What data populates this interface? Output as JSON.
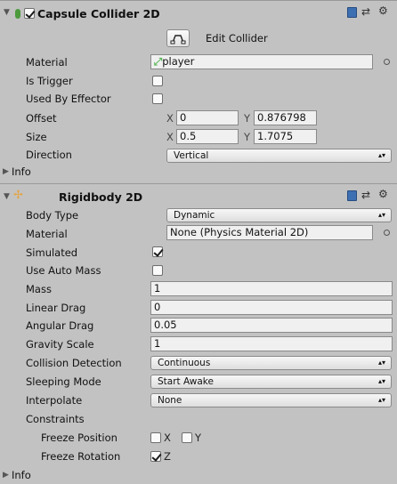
{
  "capsule": {
    "title": "Capsule Collider 2D",
    "enabled": true,
    "edit_collider_label": "Edit Collider",
    "rows": {
      "material_label": "Material",
      "material_value": "player",
      "is_trigger_label": "Is Trigger",
      "is_trigger": false,
      "used_by_effector_label": "Used By Effector",
      "used_by_effector": false,
      "offset_label": "Offset",
      "offset_x": "0",
      "offset_y": "0.876798",
      "size_label": "Size",
      "size_x": "0.5",
      "size_y": "1.7075",
      "direction_label": "Direction",
      "direction_value": "Vertical",
      "info_label": "Info"
    },
    "axis_x": "X",
    "axis_y": "Y"
  },
  "rigidbody": {
    "title": "Rigidbody 2D",
    "rows": {
      "body_type_label": "Body Type",
      "body_type_value": "Dynamic",
      "material_label": "Material",
      "material_value": "None (Physics Material 2D)",
      "simulated_label": "Simulated",
      "simulated": true,
      "use_auto_mass_label": "Use Auto Mass",
      "use_auto_mass": false,
      "mass_label": "Mass",
      "mass_value": "1",
      "linear_drag_label": "Linear Drag",
      "linear_drag_value": "0",
      "angular_drag_label": "Angular Drag",
      "angular_drag_value": "0.05",
      "gravity_scale_label": "Gravity Scale",
      "gravity_scale_value": "1",
      "collision_detection_label": "Collision Detection",
      "collision_detection_value": "Continuous",
      "sleeping_mode_label": "Sleeping Mode",
      "sleeping_mode_value": "Start Awake",
      "interpolate_label": "Interpolate",
      "interpolate_value": "None",
      "constraints_label": "Constraints",
      "freeze_position_label": "Freeze Position",
      "freeze_position_x": false,
      "freeze_position_y": false,
      "freeze_rotation_label": "Freeze Rotation",
      "freeze_rotation_z": true,
      "info_label": "Info"
    },
    "axis_x": "X",
    "axis_y": "Y",
    "axis_z": "Z"
  },
  "icons": {
    "collider": "capsule-collider-icon",
    "rigidbody": "rigidbody-icon",
    "help": "help-book-icon",
    "presets": "presets-icon",
    "settings": "gear-icon",
    "object_picker": "object-picker-icon",
    "edit_collider": "edit-collider-icon"
  },
  "colors": {
    "panel_bg": "#c2c2c2",
    "field_bg": "#f0f0f0",
    "collider_icon": "#5cb85c",
    "help_icon": "#3d6fb3",
    "rigidbody_icon": "#e8a33a"
  }
}
